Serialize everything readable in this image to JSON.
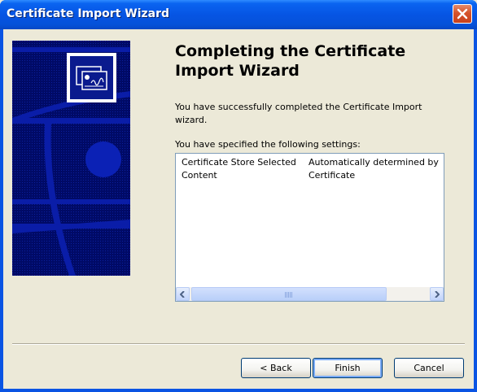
{
  "window": {
    "title": "Certificate Import Wizard"
  },
  "icons": {
    "close": "close-x-icon",
    "certificate": "certificate-icon",
    "scroll_left": "arrow-left-icon",
    "scroll_right": "arrow-right-icon"
  },
  "colors": {
    "titlebar": "#0a54e3",
    "dialog_bg": "#ece9d8",
    "banner": "#000c6e",
    "close_button": "#d5532b"
  },
  "main": {
    "heading": "Completing the Certificate Import Wizard",
    "intro": "You have successfully completed the Certificate Import wizard.",
    "settings_label": "You have specified the following settings:",
    "settings": [
      {
        "name": "Certificate Store Selected",
        "value": "Automatically determined by"
      },
      {
        "name": "Content",
        "value": "Certificate"
      }
    ]
  },
  "buttons": {
    "back": "< Back",
    "finish": "Finish",
    "cancel": "Cancel"
  }
}
